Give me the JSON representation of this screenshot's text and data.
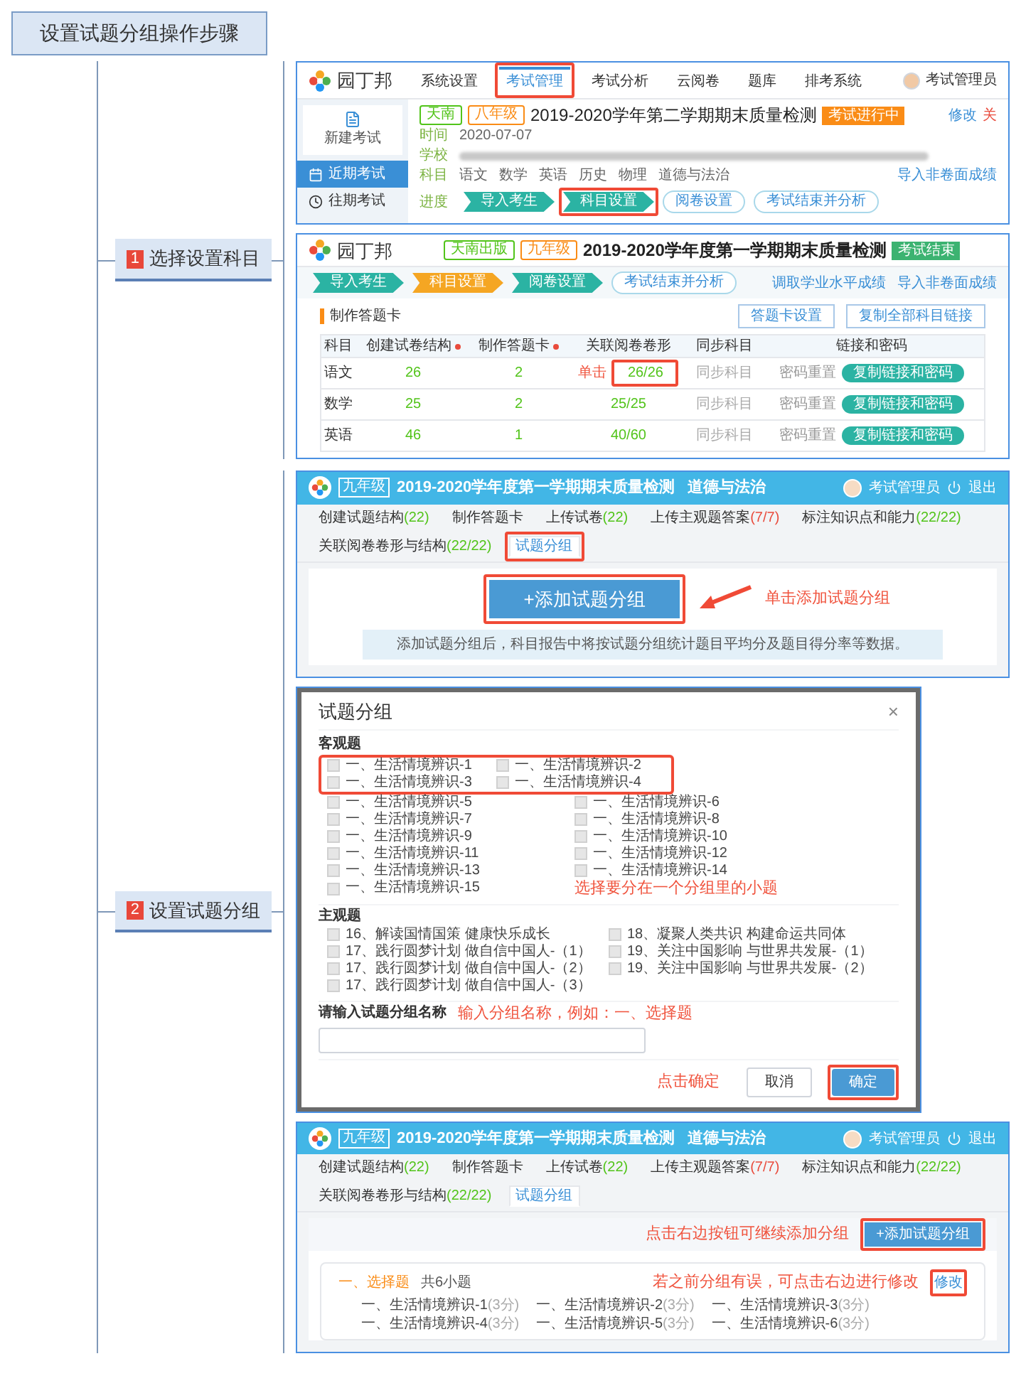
{
  "title": "设置试题分组操作步骤",
  "branches": [
    {
      "number": "1",
      "label": "选择设置科目"
    },
    {
      "number": "2",
      "label": "设置试题分组"
    }
  ],
  "exam_list_screen": {
    "logo": "园丁邦",
    "nav": [
      {
        "label": "系统设置",
        "selected": false,
        "boxed": false
      },
      {
        "label": "考试管理",
        "selected": true,
        "boxed": true
      },
      {
        "label": "考试分析",
        "selected": false,
        "boxed": false
      },
      {
        "label": "云阅卷",
        "selected": false,
        "boxed": false
      },
      {
        "label": "题库",
        "selected": false,
        "boxed": false
      },
      {
        "label": "排考系统",
        "selected": false,
        "boxed": false
      }
    ],
    "user": "考试管理员",
    "new_exam": "新建考试",
    "sidebar": [
      {
        "label": "近期考试",
        "selected": true
      },
      {
        "label": "往期考试",
        "selected": false
      }
    ],
    "tags": [
      {
        "label": "天南",
        "color": "#52c41a"
      },
      {
        "label": "八年级",
        "color": "#fa8c16"
      }
    ],
    "title": "2019-2020学年第二学期期末质量检测",
    "badge": "考试进行中",
    "actions": [
      {
        "label": "修改",
        "kind": "edit"
      },
      {
        "label": "关",
        "kind": "danger"
      }
    ],
    "time_label": "时间",
    "time": "2020-07-07",
    "school_label": "学校",
    "subjects_label": "科目",
    "subjects": [
      "语文",
      "数学",
      "英语",
      "历史",
      "物理",
      "道德与法治"
    ],
    "import_link": "导入非卷面成绩",
    "progress_label": "进度",
    "progress": [
      {
        "label": "导入考生",
        "kind": "done",
        "boxed": false
      },
      {
        "label": "科目设置",
        "kind": "done",
        "boxed": true
      },
      {
        "label": "阅卷设置",
        "kind": "todo",
        "boxed": false
      },
      {
        "label": "考试结束并分析",
        "kind": "todo",
        "boxed": false
      }
    ]
  },
  "answer_card_screen": {
    "logo": "园丁邦",
    "tags": [
      {
        "label": "天南出版",
        "color": "#52c41a"
      },
      {
        "label": "九年级",
        "color": "#fa8c16"
      }
    ],
    "title": "2019-2020学年度第一学期期末质量检测",
    "badge": "考试结束",
    "progress": [
      {
        "label": "导入考生",
        "kind": "done",
        "boxed": false
      },
      {
        "label": "科目设置",
        "kind": "current",
        "boxed": false
      },
      {
        "label": "阅卷设置",
        "kind": "done",
        "boxed": false
      },
      {
        "label": "考试结束并分析",
        "kind": "todo",
        "boxed": false
      }
    ],
    "links": [
      "调取学业水平成绩",
      "导入非卷面成绩"
    ],
    "section": "制作答题卡",
    "buttons": [
      "答题卡设置",
      "复制全部科目链接"
    ],
    "columns": [
      {
        "label": "科目",
        "required": false
      },
      {
        "label": "创建试卷结构",
        "required": true
      },
      {
        "label": "制作答题卡",
        "required": true
      },
      {
        "label": "关联阅卷卷形",
        "required": false
      },
      {
        "label": "同步科目",
        "required": false
      },
      {
        "label": "链接和密码",
        "required": false
      }
    ],
    "callout": "单击",
    "rows": [
      {
        "subject": "语文",
        "structure": "26",
        "card": "2",
        "link": "26/26",
        "boxed": true,
        "sync": "同步科目",
        "reset": "密码重置",
        "copy": "复制链接和密码"
      },
      {
        "subject": "数学",
        "structure": "25",
        "card": "2",
        "link": "25/25",
        "boxed": false,
        "sync": "同步科目",
        "reset": "密码重置",
        "copy": "复制链接和密码"
      },
      {
        "subject": "英语",
        "structure": "46",
        "card": "1",
        "link": "40/60",
        "boxed": false,
        "sync": "同步科目",
        "reset": "密码重置",
        "copy": "复制链接和密码"
      }
    ]
  },
  "subject_screen": {
    "grade": "九年级",
    "title": "2019-2020学年度第一学期期末质量检测",
    "subject": "道德与法治",
    "user": "考试管理员",
    "logout": "退出",
    "tabs": [
      {
        "label": "创建试题结构",
        "count": "(22)",
        "count_ok": true,
        "selected": false,
        "boxed": false
      },
      {
        "label": "制作答题卡",
        "selected": false,
        "boxed": false
      },
      {
        "label": "上传试卷",
        "count": "(22)",
        "count_ok": true,
        "selected": false,
        "boxed": false
      },
      {
        "label": "上传主观题答案",
        "count": "(7/7)",
        "count_ok": false,
        "selected": false,
        "boxed": false
      },
      {
        "label": "标注知识点和能力",
        "count": "(22/22)",
        "count_ok": true,
        "selected": false,
        "boxed": false
      },
      {
        "label": "关联阅卷卷形与结构",
        "count": "(22/22)",
        "count_ok": true,
        "selected": false,
        "boxed": false
      },
      {
        "label": "试题分组",
        "selected": true,
        "boxed": true
      }
    ],
    "add_button": "+添加试题分组",
    "callout": "单击添加试题分组",
    "info": "添加试题分组后，科目报告中将按试题分组统计题目平均分及题目得分率等数据。"
  },
  "group_dialog": {
    "title": "试题分组",
    "close": "×",
    "objective_heading": "客观题",
    "objective": [
      {
        "label": "一、生活情境辨识-1",
        "checked": false,
        "boxed": true
      },
      {
        "label": "一、生活情境辨识-2",
        "checked": false,
        "boxed": true
      },
      {
        "label": "一、生活情境辨识-3",
        "checked": false,
        "boxed": true
      },
      {
        "label": "一、生活情境辨识-4",
        "checked": false,
        "boxed": true
      },
      {
        "label": "一、生活情境辨识-5",
        "checked": false,
        "boxed": false
      },
      {
        "label": "一、生活情境辨识-6",
        "checked": false,
        "boxed": false
      },
      {
        "label": "一、生活情境辨识-7",
        "checked": false,
        "boxed": false
      },
      {
        "label": "一、生活情境辨识-8",
        "checked": false,
        "boxed": false
      },
      {
        "label": "一、生活情境辨识-9",
        "checked": false,
        "boxed": false
      },
      {
        "label": "一、生活情境辨识-10",
        "checked": false,
        "boxed": false
      },
      {
        "label": "一、生活情境辨识-11",
        "checked": false,
        "boxed": false
      },
      {
        "label": "一、生活情境辨识-12",
        "checked": false,
        "boxed": false
      },
      {
        "label": "一、生活情境辨识-13",
        "checked": false,
        "boxed": false
      },
      {
        "label": "一、生活情境辨识-14",
        "checked": false,
        "boxed": false
      },
      {
        "label": "一、生活情境辨识-15",
        "checked": false,
        "boxed": false
      }
    ],
    "objective_callout": "选择要分在一个分组里的小题",
    "subjective_heading": "主观题",
    "subjective": [
      {
        "label": "16、解读国情国策 健康快乐成长",
        "checked": false
      },
      {
        "label": "17、践行圆梦计划 做自信中国人-（1）",
        "checked": false
      },
      {
        "label": "17、践行圆梦计划 做自信中国人-（2）",
        "checked": false
      },
      {
        "label": "17、践行圆梦计划 做自信中国人-（3）",
        "checked": false
      },
      {
        "label": "18、凝聚人类共识 构建命运共同体",
        "checked": false
      },
      {
        "label": "19、关注中国影响 与世界共发展-（1）",
        "checked": false
      },
      {
        "label": "19、关注中国影响 与世界共发展-（2）",
        "checked": false
      }
    ],
    "name_label": "请输入试题分组名称",
    "name_callout": "输入分组名称，例如：一、选择题",
    "confirm_callout": "点击确定",
    "buttons": [
      {
        "label": "取消",
        "kind": "default",
        "boxed": false
      },
      {
        "label": "确定",
        "kind": "primary",
        "boxed": true
      }
    ]
  },
  "group_result_screen": {
    "grade": "九年级",
    "title": "2019-2020学年度第一学期期末质量检测",
    "subject": "道德与法治",
    "user": "考试管理员",
    "logout": "退出",
    "tabs": [
      {
        "label": "创建试题结构",
        "count": "(22)",
        "count_ok": true,
        "selected": false,
        "boxed": false
      },
      {
        "label": "制作答题卡",
        "selected": false,
        "boxed": false
      },
      {
        "label": "上传试卷",
        "count": "(22)",
        "count_ok": true,
        "selected": false,
        "boxed": false
      },
      {
        "label": "上传主观题答案",
        "count": "(7/7)",
        "count_ok": false,
        "selected": false,
        "boxed": false
      },
      {
        "label": "标注知识点和能力",
        "count": "(22/22)",
        "count_ok": true,
        "selected": false,
        "boxed": false
      },
      {
        "label": "关联阅卷卷形与结构",
        "count": "(22/22)",
        "count_ok": true,
        "selected": false,
        "boxed": false
      },
      {
        "label": "试题分组",
        "selected": true,
        "boxed": false
      }
    ],
    "toolbar_callout": "点击右边按钮可继续添加分组",
    "add_button": "+添加试题分组",
    "add_boxed": true,
    "group": {
      "name": "一、选择题",
      "count": "共6小题",
      "callout": "若之前分组有误，可点击右边进行修改",
      "edit": "修改",
      "edit_boxed": true,
      "items": [
        {
          "label": "一、生活情境辨识-1",
          "score": "(3分)"
        },
        {
          "label": "一、生活情境辨识-2",
          "score": "(3分)"
        },
        {
          "label": "一、生活情境辨识-3",
          "score": "(3分)"
        },
        {
          "label": "一、生活情境辨识-4",
          "score": "(3分)"
        },
        {
          "label": "一、生活情境辨识-5",
          "score": "(3分)"
        },
        {
          "label": "一、生活情境辨识-6",
          "score": "(3分)"
        }
      ]
    }
  }
}
